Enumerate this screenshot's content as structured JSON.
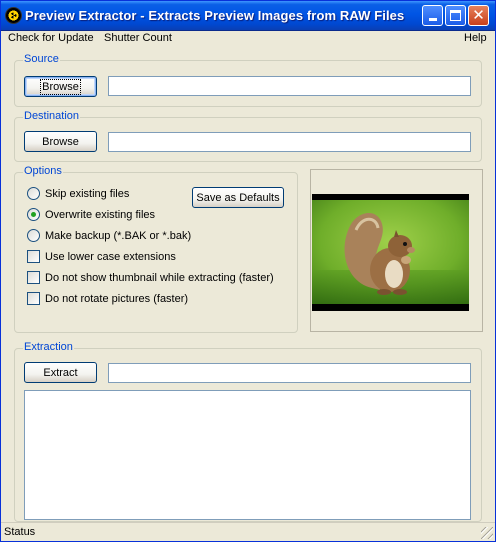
{
  "window": {
    "title": "Preview Extractor - Extracts Preview Images from RAW Files"
  },
  "menu": {
    "check_update": "Check for Update",
    "shutter_count": "Shutter Count",
    "help": "Help"
  },
  "source": {
    "label": "Source",
    "browse": "Browse",
    "path": ""
  },
  "destination": {
    "label": "Destination",
    "browse": "Browse",
    "path": ""
  },
  "options": {
    "label": "Options",
    "save_defaults": "Save as Defaults",
    "radio": [
      {
        "label": "Skip existing files",
        "checked": false
      },
      {
        "label": "Overwrite existing files",
        "checked": true
      },
      {
        "label": "Make backup (*.BAK or *.bak)",
        "checked": false
      }
    ],
    "checks": [
      {
        "label": "Use lower case extensions",
        "checked": false
      },
      {
        "label": "Do not show thumbnail while extracting (faster)",
        "checked": false
      },
      {
        "label": "Do not rotate pictures (faster)",
        "checked": false
      }
    ]
  },
  "extraction": {
    "label": "Extraction",
    "extract": "Extract",
    "progress": "",
    "log": ""
  },
  "status": {
    "text": "Status"
  },
  "icons": [
    "app-icon",
    "minimize-icon",
    "maximize-icon",
    "close-icon",
    "squirrel-thumbnail",
    "resize-grip-icon"
  ]
}
